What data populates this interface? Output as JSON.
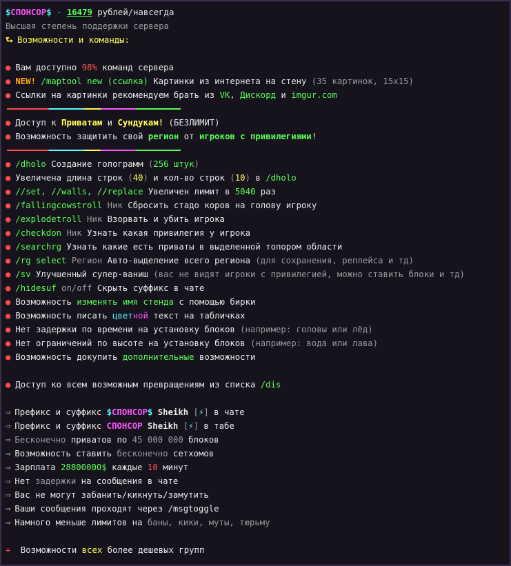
{
  "header": {
    "sponsor_left": "$",
    "sponsor_name": "СПОНСОР",
    "sponsor_right": "$",
    "separator": "-",
    "price": "16479",
    "price_suffix": "рублей/навсегда",
    "subtitle": "Высшая степень поддержки сервера",
    "section_arrow": "⮑",
    "section_title": "Возможности и команды:"
  },
  "block1": {
    "item1": {
      "a": "Вам доступно ",
      "b": "98%",
      "c": " команд сервера"
    },
    "item2": {
      "a": "NEW!",
      "b": " /maptool new ",
      "c": "(ссылка)",
      "d": " Картинки из интернета на стену ",
      "e": "(35 картинок, 15x15)"
    },
    "item3": {
      "a": "Ссылки на картинки рекомендуем брать из ",
      "b": "VK",
      "c": ", ",
      "d": "Дискорд",
      "e": " и ",
      "f": "imgur.com"
    }
  },
  "block2": {
    "item1": {
      "a": "Доступ к ",
      "b": "Приватам",
      "c": " и ",
      "d": "Сундукам!",
      "e": " (БЕЗЛИМИТ)"
    },
    "item2": {
      "a": "Возможность защитить свой ",
      "b": "регион",
      "c": " от ",
      "d": "игроков с привилегиями",
      "e": "!"
    }
  },
  "commands": [
    {
      "parts": [
        [
          "c-green",
          "/dholo"
        ],
        [
          "",
          " Создание голограмм "
        ],
        [
          "c-gray",
          "("
        ],
        [
          "c-green",
          "256 штук"
        ],
        [
          "c-gray",
          ")"
        ]
      ]
    },
    {
      "parts": [
        [
          "",
          "Увеличена длина строк "
        ],
        [
          "c-gray",
          "("
        ],
        [
          "c-yellow",
          "40"
        ],
        [
          "c-gray",
          ")"
        ],
        [
          "",
          " и кол-во строк "
        ],
        [
          "c-gray",
          "("
        ],
        [
          "c-yellow",
          "10"
        ],
        [
          "c-gray",
          ")"
        ],
        [
          "",
          " в "
        ],
        [
          "c-green",
          "/dholo"
        ]
      ]
    },
    {
      "parts": [
        [
          "c-green",
          "//set, //walls, //replace"
        ],
        [
          "",
          " Увеличен лимит в "
        ],
        [
          "c-green",
          "5040"
        ],
        [
          "",
          " раз"
        ]
      ]
    },
    {
      "parts": [
        [
          "c-green",
          "/fallingcowstroll"
        ],
        [
          "c-gray",
          " Ник"
        ],
        [
          "",
          " Сбросить стадо коров на голову игроку"
        ]
      ]
    },
    {
      "parts": [
        [
          "c-green",
          "/explodetroll"
        ],
        [
          "c-gray",
          " Ник"
        ],
        [
          "",
          " Взорвать и убить игрока"
        ]
      ]
    },
    {
      "parts": [
        [
          "c-green",
          "/checkdon"
        ],
        [
          "c-gray",
          " Ник"
        ],
        [
          "",
          " Узнать какая привилегия у игрока"
        ]
      ]
    },
    {
      "parts": [
        [
          "c-green",
          "/searchrg"
        ],
        [
          "",
          " Узнать какие есть приваты в выделенной топором области"
        ]
      ]
    },
    {
      "parts": [
        [
          "c-green",
          "/rg select"
        ],
        [
          "c-gray",
          " Регион"
        ],
        [
          "",
          " Авто-выделение всего региона "
        ],
        [
          "c-gray",
          "(для сохранения, реплейса и тд)"
        ]
      ]
    },
    {
      "parts": [
        [
          "c-green",
          "/sv"
        ],
        [
          "",
          " Улучшенный супер-ваниш "
        ],
        [
          "c-gray",
          "(вас не видят игроки с привилегией, можно ставить блоки и тд)"
        ]
      ]
    },
    {
      "parts": [
        [
          "c-green",
          "/hidesuf"
        ],
        [
          "c-gray",
          " on/off"
        ],
        [
          "",
          " Скрыть суффикс в чате"
        ]
      ]
    },
    {
      "parts": [
        [
          "",
          "Возможность "
        ],
        [
          "c-green",
          "изменять имя стенда"
        ],
        [
          "",
          " с помощью бирки"
        ]
      ]
    },
    {
      "parts": [
        [
          "",
          "Возможность писать "
        ],
        [
          "c-aqua",
          "цвет"
        ],
        [
          "c-pink",
          "ной"
        ],
        [
          "",
          " текст на табличках"
        ]
      ]
    },
    {
      "parts": [
        [
          "",
          "Нет задержки по времени на установку блоков "
        ],
        [
          "c-gray",
          "(например: головы или лёд)"
        ]
      ]
    },
    {
      "parts": [
        [
          "",
          "Нет ограничений по высоте на установку блоков "
        ],
        [
          "c-gray",
          "(например: вода или лава)"
        ]
      ]
    },
    {
      "parts": [
        [
          "",
          "Возможность докупить "
        ],
        [
          "c-green",
          "дополнительные"
        ],
        [
          "",
          " возможности"
        ]
      ]
    }
  ],
  "transform": {
    "a": "Доступ ко всем возможным превращениям из списка ",
    "b": "/dis"
  },
  "perks": {
    "chat_prefix": {
      "a": "Префикс и суффикс ",
      "dl": "$",
      "name": "СПОНСОР",
      "dr": "$",
      "nick": " Sheikh ",
      "bl": "[",
      "bolt": "⚡",
      "br": "]",
      "tail": " в чате"
    },
    "tab_prefix": {
      "a": "Префикс и суффикс ",
      "name": "СПОНСОР",
      "nick": " Sheikh ",
      "bl": "[",
      "bolt": "⚡",
      "br": "]",
      "tail": " в табе"
    },
    "list": [
      {
        "parts": [
          [
            "c-gray",
            "Бесконечно"
          ],
          [
            "",
            " приватов по "
          ],
          [
            "c-gray",
            "45 000 000"
          ],
          [
            "",
            " блоков"
          ]
        ]
      },
      {
        "parts": [
          [
            "",
            "Возможность ставить "
          ],
          [
            "c-gray",
            "бесконечно"
          ],
          [
            "",
            " сетхомов"
          ]
        ]
      },
      {
        "parts": [
          [
            "",
            "Зарплата "
          ],
          [
            "c-green",
            "28800000$"
          ],
          [
            "",
            " каждые "
          ],
          [
            "c-red",
            "10"
          ],
          [
            "",
            " минут"
          ]
        ]
      },
      {
        "parts": [
          [
            "",
            "Нет "
          ],
          [
            "c-gray",
            "задержки"
          ],
          [
            "",
            " на сообщения в чате"
          ]
        ]
      },
      {
        "parts": [
          [
            "",
            "Вас не могут забанить/кикнуть/замутить"
          ]
        ]
      },
      {
        "parts": [
          [
            "",
            "Ваши сообщения проходят через /msgtoggle"
          ]
        ]
      },
      {
        "parts": [
          [
            "",
            "Намного меньше лимитов на "
          ],
          [
            "c-gray",
            "баны, кики, муты, тюрьму"
          ]
        ]
      }
    ]
  },
  "footer": {
    "plus": "+",
    "a": " Возможности ",
    "b": "всех",
    "c": " более дешевых групп"
  },
  "glyphs": {
    "bullet": "●",
    "arrow": "⇨"
  },
  "colors": {
    "green": "#55ff55",
    "yellow": "#ffff55",
    "pink": "#ff55ff",
    "aqua": "#55ffff",
    "red": "#ff5555",
    "bullet": "#ff4a4a"
  }
}
